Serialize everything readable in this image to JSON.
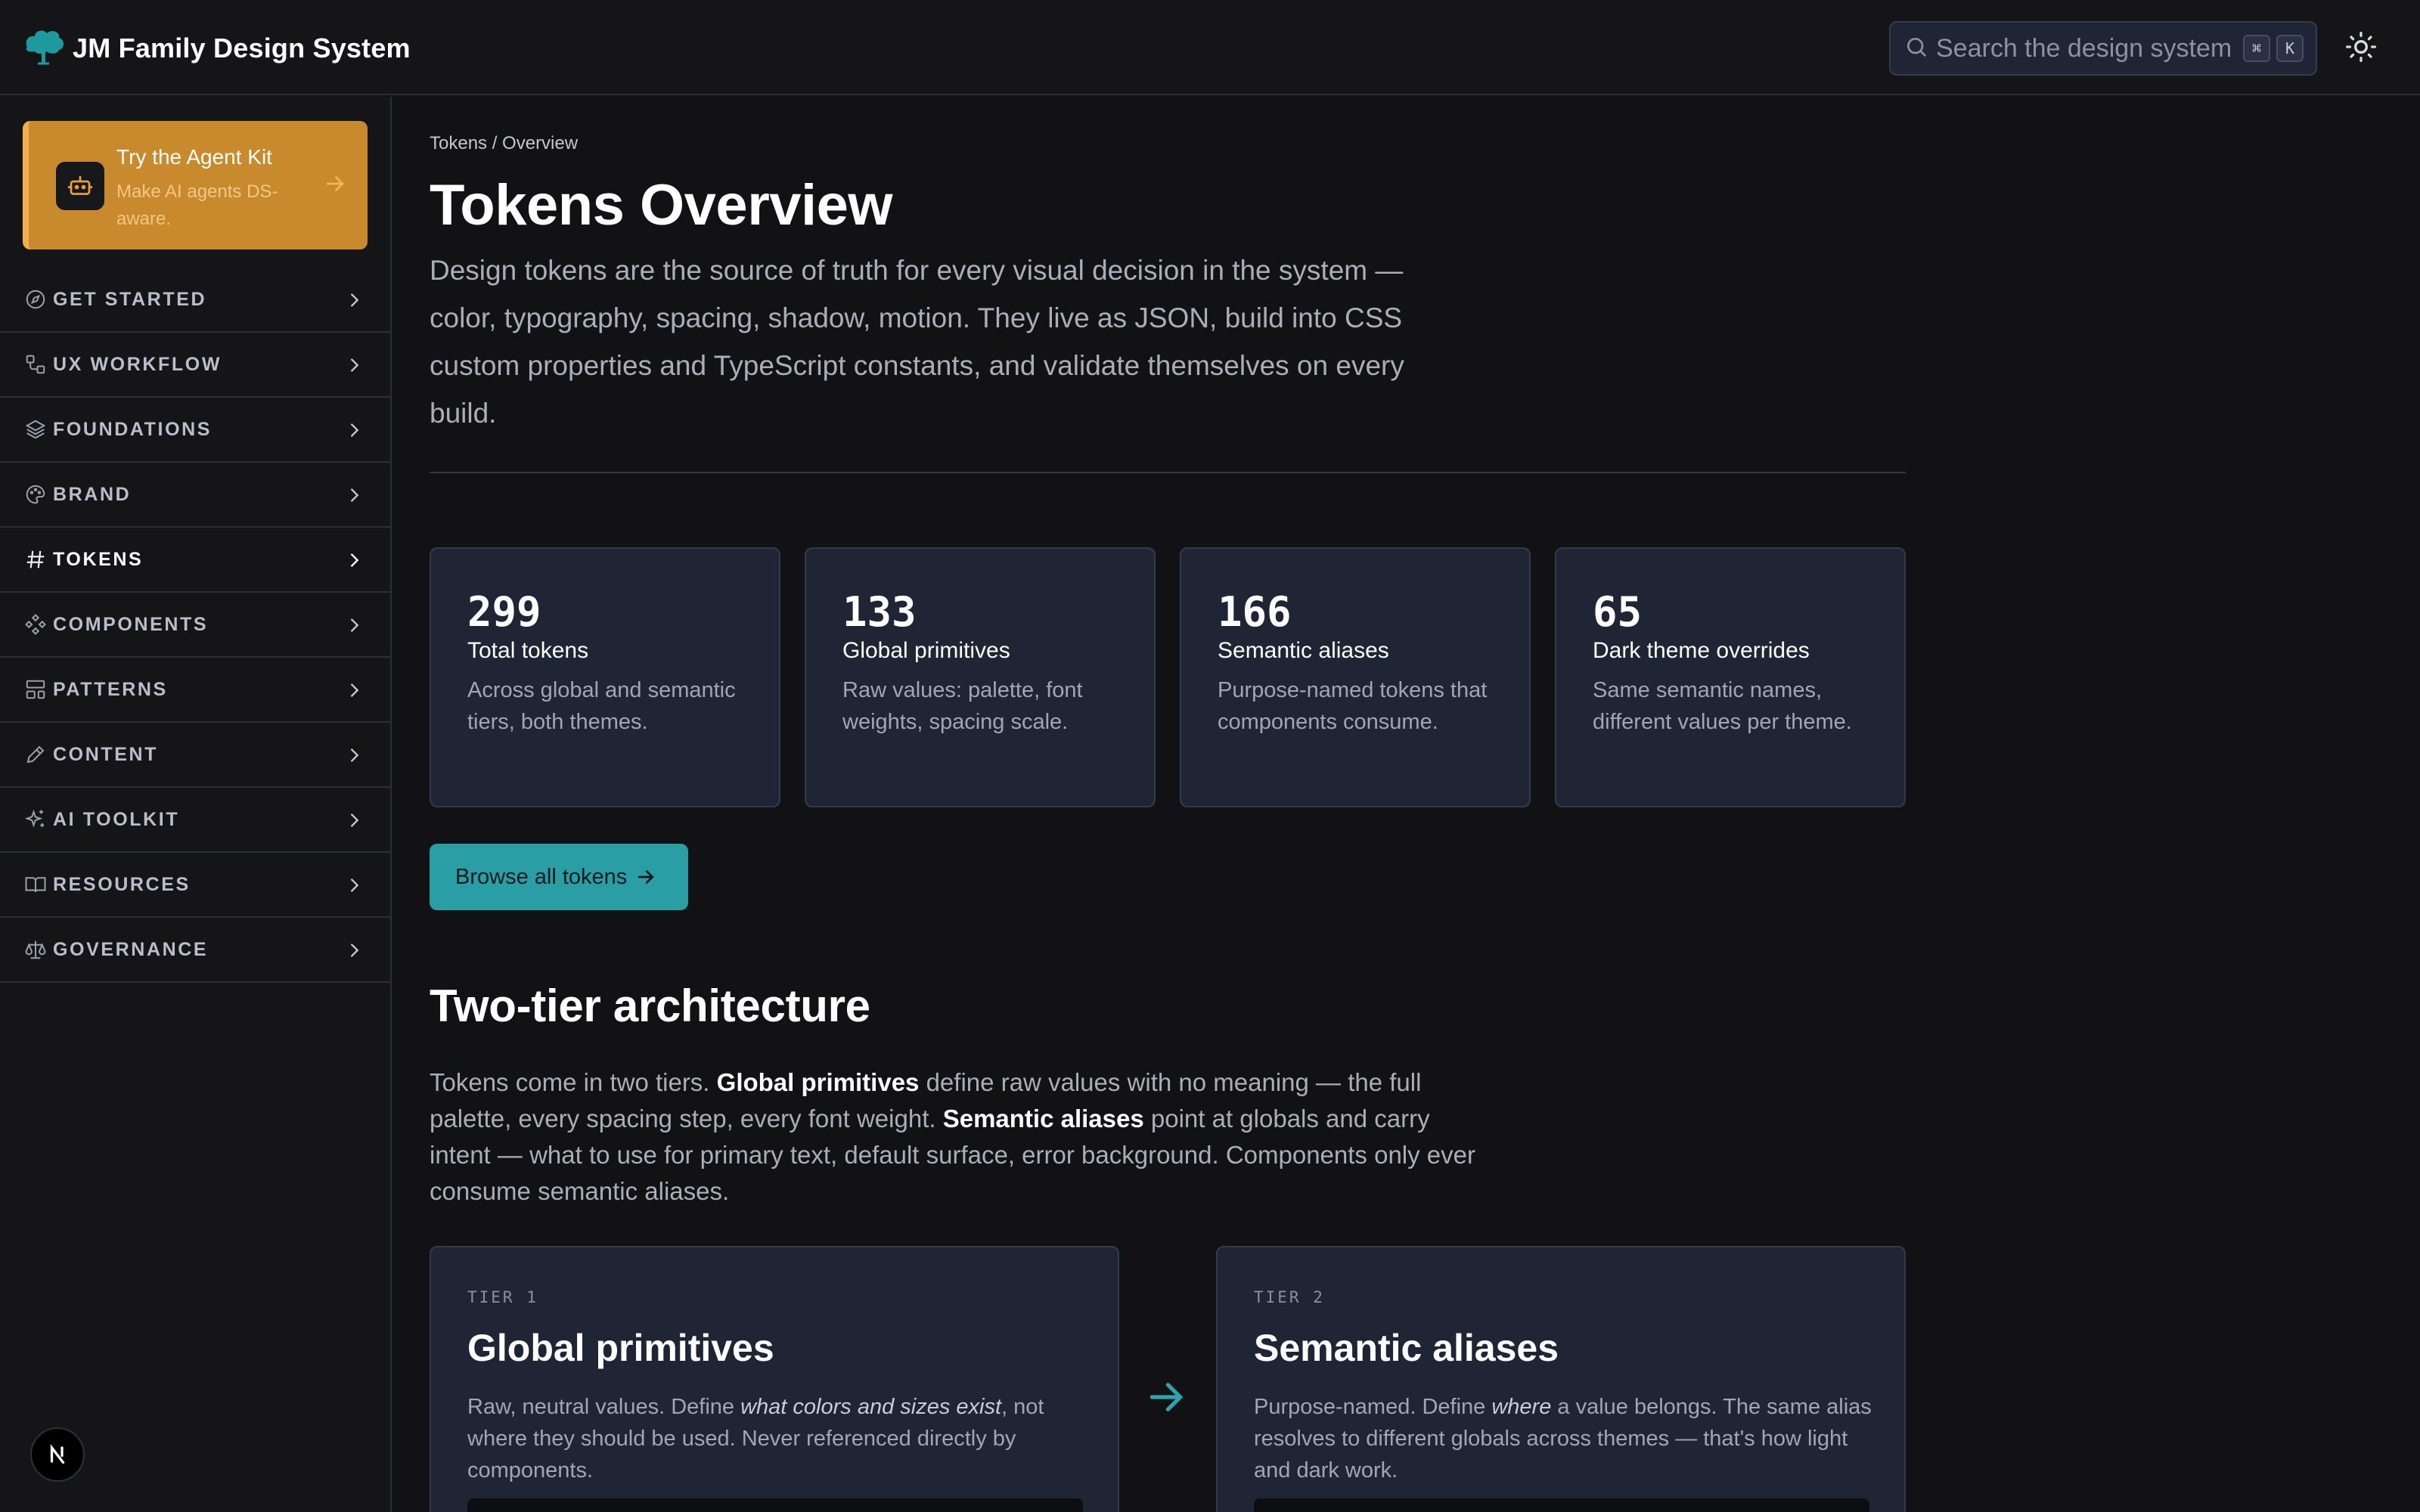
{
  "header": {
    "logo_icon": "tree-icon",
    "title": "JM Family Design System",
    "search": {
      "placeholder": "Search the design system",
      "shortcut": [
        "⌘",
        "K"
      ],
      "icon": "search-icon"
    },
    "theme_toggle_icon": "sun-icon"
  },
  "sidebar": {
    "promo": {
      "icon": "robot-icon",
      "title": "Try the Agent Kit",
      "subtitle": "Make AI agents DS-aware.",
      "arrow_icon": "arrow-right-icon"
    },
    "items": [
      {
        "label": "GET STARTED",
        "icon": "compass-icon"
      },
      {
        "label": "UX WORKFLOW",
        "icon": "workflow-icon"
      },
      {
        "label": "FOUNDATIONS",
        "icon": "layers-icon"
      },
      {
        "label": "BRAND",
        "icon": "palette-icon"
      },
      {
        "label": "TOKENS",
        "icon": "hash-icon",
        "active": true
      },
      {
        "label": "COMPONENTS",
        "icon": "component-icon"
      },
      {
        "label": "PATTERNS",
        "icon": "layout-icon"
      },
      {
        "label": "CONTENT",
        "icon": "pen-icon"
      },
      {
        "label": "AI TOOLKIT",
        "icon": "sparkles-icon"
      },
      {
        "label": "RESOURCES",
        "icon": "book-icon"
      },
      {
        "label": "GOVERNANCE",
        "icon": "scale-icon"
      }
    ],
    "footer_logo_icon": "nextjs-logo-icon"
  },
  "main": {
    "breadcrumb": "Tokens / Overview",
    "title": "Tokens Overview",
    "intro": "Design tokens are the source of truth for every visual decision in the system — color, typography, spacing, shadow, motion. They live as JSON, build into CSS custom properties and TypeScript constants, and validate themselves on every build.",
    "stats": [
      {
        "value": "299",
        "title": "Total tokens",
        "desc": "Across global and semantic tiers, both themes."
      },
      {
        "value": "133",
        "title": "Global primitives",
        "desc": "Raw values: palette, font weights, spacing scale."
      },
      {
        "value": "166",
        "title": "Semantic aliases",
        "desc": "Purpose-named tokens that components consume."
      },
      {
        "value": "65",
        "title": "Dark theme overrides",
        "desc": "Same semantic names, different values per theme."
      }
    ],
    "browse_button": "Browse all tokens",
    "section": {
      "title": "Two-tier architecture",
      "p1": "Tokens come in two tiers. ",
      "b1": "Global primitives",
      "p2": " define raw values with no meaning — the full palette, every spacing step, every font weight. ",
      "b2": "Semantic aliases",
      "p3": " point at globals and carry intent — what to use for primary text, default surface, error background. Components only ever consume semantic aliases."
    },
    "tiers": [
      {
        "kicker": "TIER 1",
        "title": "Global primitives",
        "d1": "Raw, neutral values. Define ",
        "em": "what colors and sizes exist",
        "d2": ", not where they should be used. Never referenced directly by components."
      },
      {
        "kicker": "TIER 2",
        "title": "Semantic aliases",
        "d1": "Purpose-named. Define ",
        "em": "where",
        "d2": " a value belongs. The same alias resolves to different globals across themes — that's how light and dark work."
      }
    ]
  },
  "colors": {
    "background": "#121215",
    "panel": "#1f2535",
    "accent_teal": "#2a9ea5",
    "promo_amber": "#c98a2d"
  }
}
